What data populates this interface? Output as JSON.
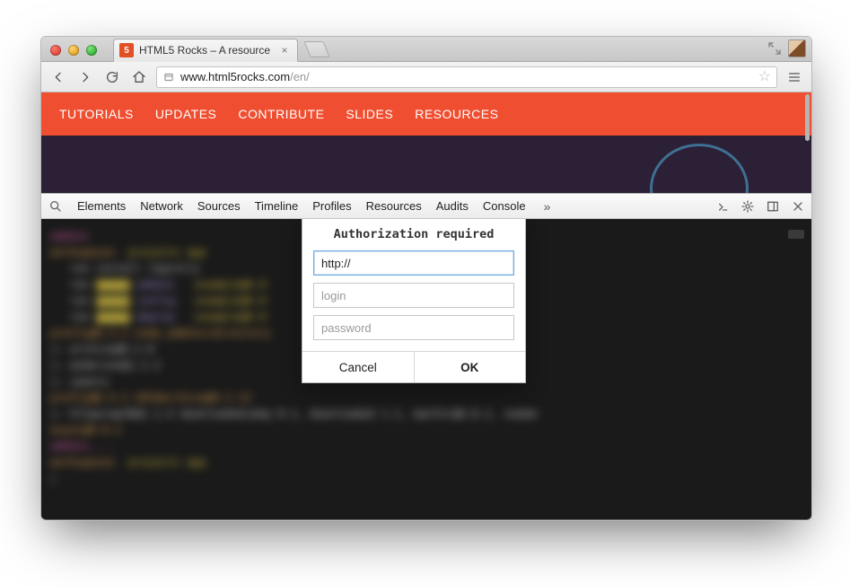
{
  "browser_tab": {
    "title": "HTML5 Rocks – A resource"
  },
  "addressbar": {
    "url_host": "www.html5rocks.com",
    "url_path": "/en/"
  },
  "site_nav": [
    "TUTORIALS",
    "UPDATES",
    "CONTRIBUTE",
    "SLIDES",
    "RESOURCES"
  ],
  "devtools": {
    "tabs": [
      "Elements",
      "Network",
      "Sources",
      "Timeline",
      "Profiles",
      "Resources",
      "Audits",
      "Console"
    ],
    "overflow_glyph": "»"
  },
  "auth_modal": {
    "title": "Authorization required",
    "url_value": "http://",
    "login_placeholder": "login",
    "password_placeholder": "password",
    "cancel_label": "Cancel",
    "ok_label": "OK"
  }
}
